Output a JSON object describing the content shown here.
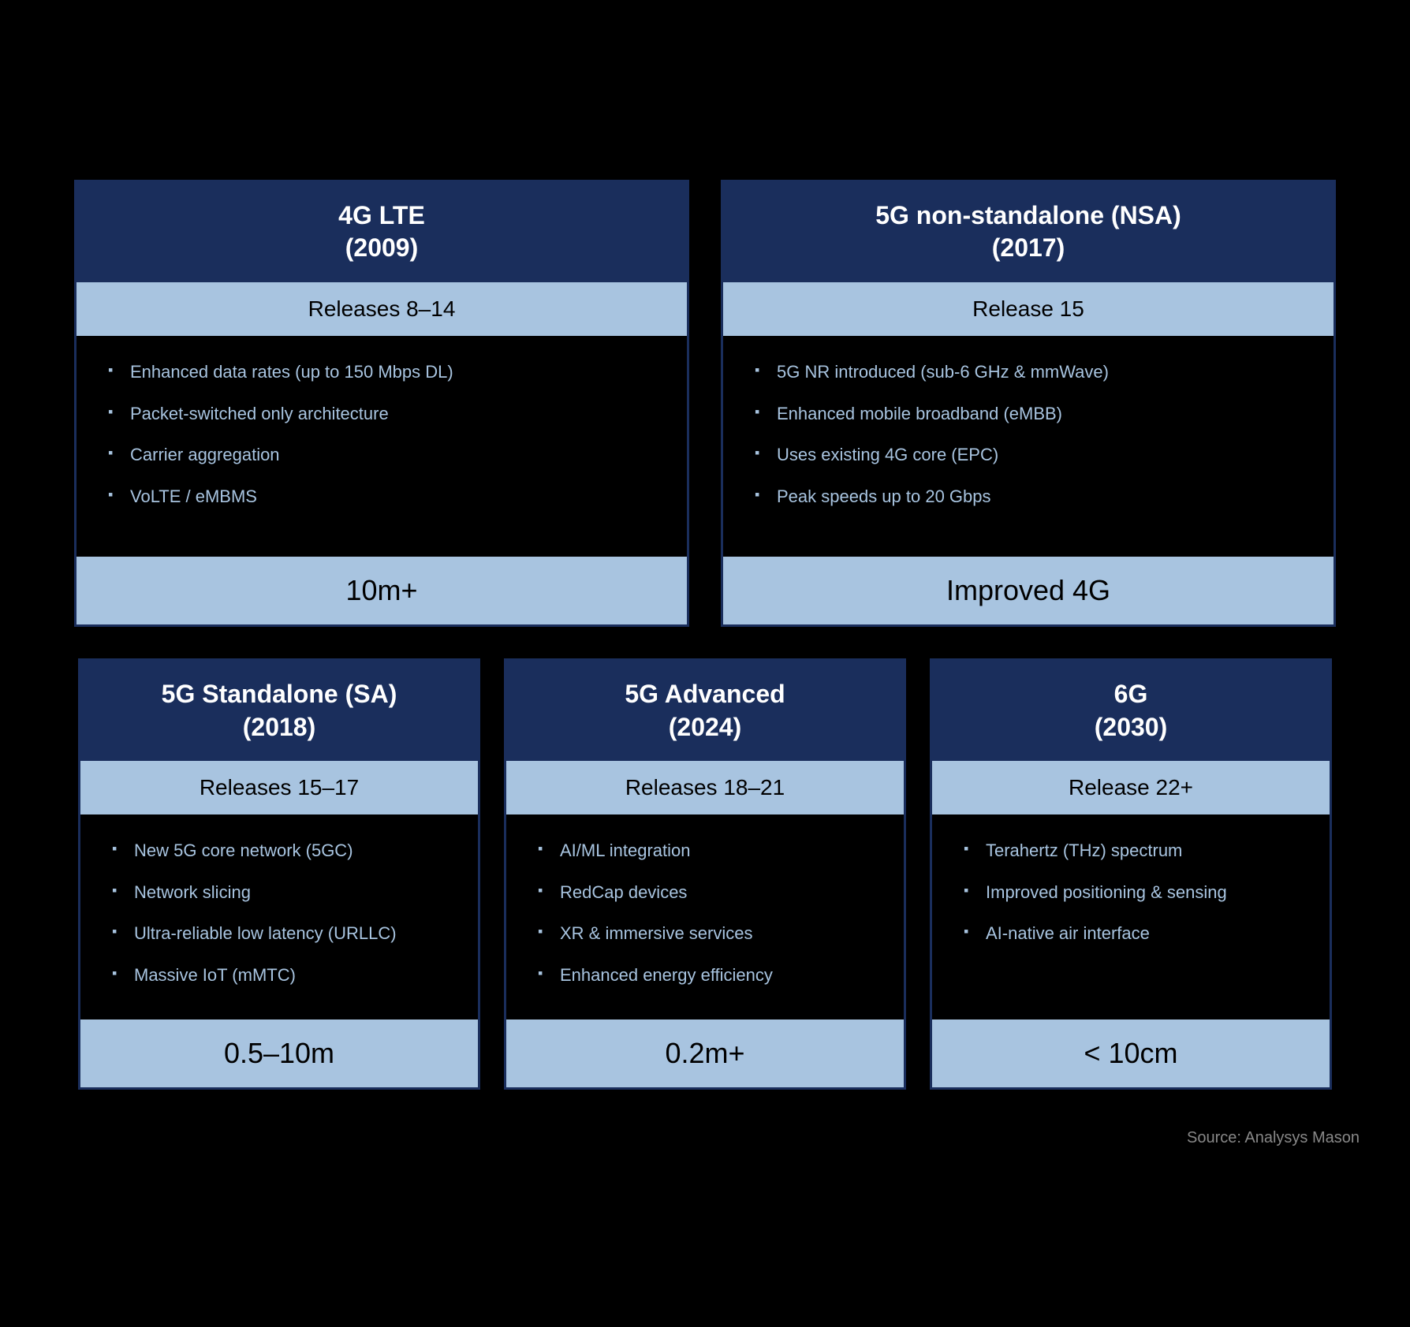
{
  "source": "Source: Analysys Mason",
  "cards": {
    "top_left": {
      "title": "4G LTE\n(2009)",
      "release": "Releases 8–14",
      "bullets": [
        "Enhanced data rates (up to 150 Mbps DL)",
        "Packet-switched only architecture",
        "Carrier aggregation",
        "VoLTE / eMBMS"
      ],
      "footer": "10m+"
    },
    "top_right": {
      "title": "5G non-standalone (NSA)\n(2017)",
      "release": "Release 15",
      "bullets": [
        "5G NR introduced (sub-6 GHz & mmWave)",
        "Enhanced mobile broadband (eMBB)",
        "Uses existing 4G core (EPC)",
        "Peak speeds up to 20 Gbps"
      ],
      "footer": "Improved 4G"
    },
    "bottom_left": {
      "title": "5G Standalone (SA)\n(2018)",
      "release": "Releases 15–17",
      "bullets": [
        "New 5G core network (5GC)",
        "Network slicing",
        "Ultra-reliable low latency (URLLC)",
        "Massive IoT (mMTC)"
      ],
      "footer": "0.5–10m"
    },
    "bottom_middle": {
      "title": "5G Advanced\n(2024)",
      "release": "Releases 18–21",
      "bullets": [
        "AI/ML integration",
        "RedCap devices",
        "XR & immersive services",
        "Enhanced energy efficiency"
      ],
      "footer": "0.2m+"
    },
    "bottom_right": {
      "title": "6G\n(2030)",
      "release": "Release 22+",
      "bullets": [
        "Terahertz (THz) spectrum",
        "Improved positioning & sensing",
        "AI-native air interface"
      ],
      "footer": "< 10cm"
    }
  }
}
